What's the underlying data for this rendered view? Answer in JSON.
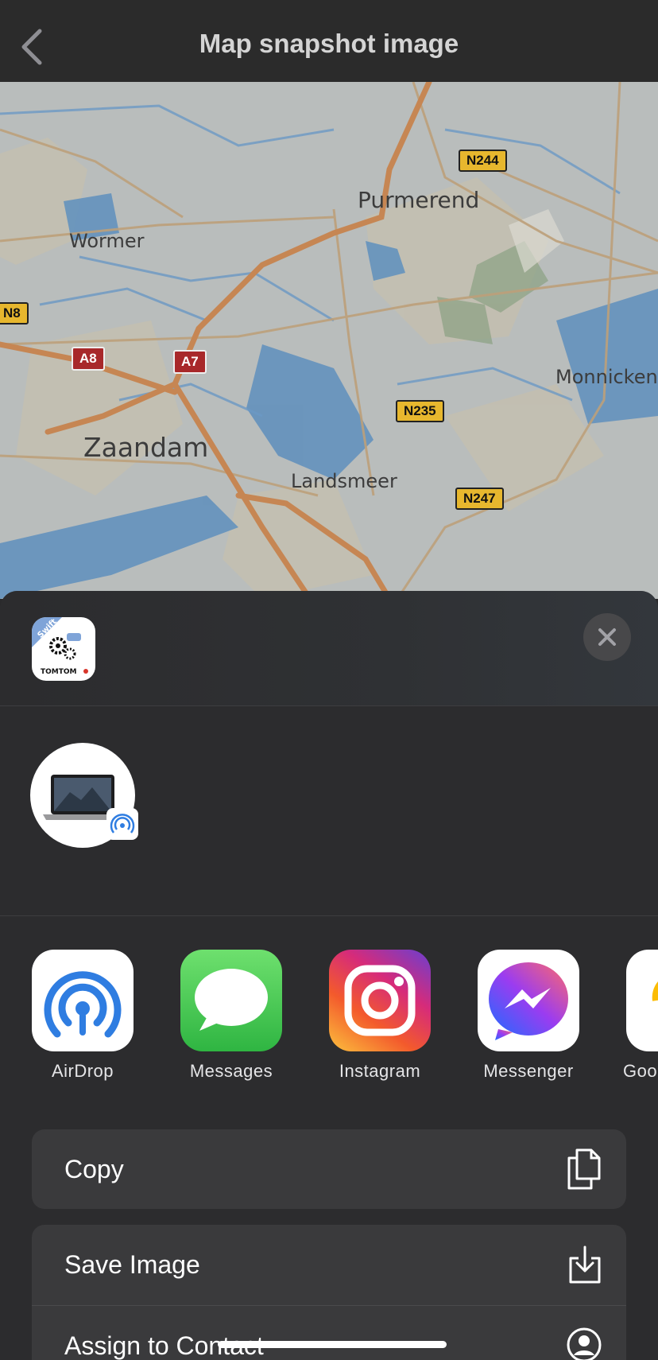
{
  "nav": {
    "title": "Map snapshot image",
    "back_icon": "chevron-left-icon"
  },
  "map": {
    "labels": {
      "purmerend": "Purmerend",
      "wormer": "Wormer",
      "zaandam": "Zaandam",
      "landsmeer": "Landsmeer",
      "monnickendam": "Monnickend"
    },
    "shields": {
      "n244": "N244",
      "n8": "N8",
      "a8": "A8",
      "a7": "A7",
      "n235": "N235",
      "n247": "N247"
    }
  },
  "share": {
    "app_icon": {
      "badge": "Swift",
      "brand": "TOMTOM"
    },
    "close_icon": "close-icon",
    "airdrop_device_icon": "laptop-icon",
    "apps": [
      {
        "label": "AirDrop",
        "icon": "airdrop-icon"
      },
      {
        "label": "Messages",
        "icon": "messages-icon"
      },
      {
        "label": "Instagram",
        "icon": "instagram-icon"
      },
      {
        "label": "Messenger",
        "icon": "messenger-icon"
      },
      {
        "label": "Goo",
        "icon": "google-icon"
      }
    ],
    "actions": [
      {
        "label": "Copy",
        "icon": "copy-icon"
      },
      {
        "label": "Save Image",
        "icon": "save-icon"
      },
      {
        "label": "Assign to Contact",
        "icon": "contact-icon"
      }
    ]
  }
}
